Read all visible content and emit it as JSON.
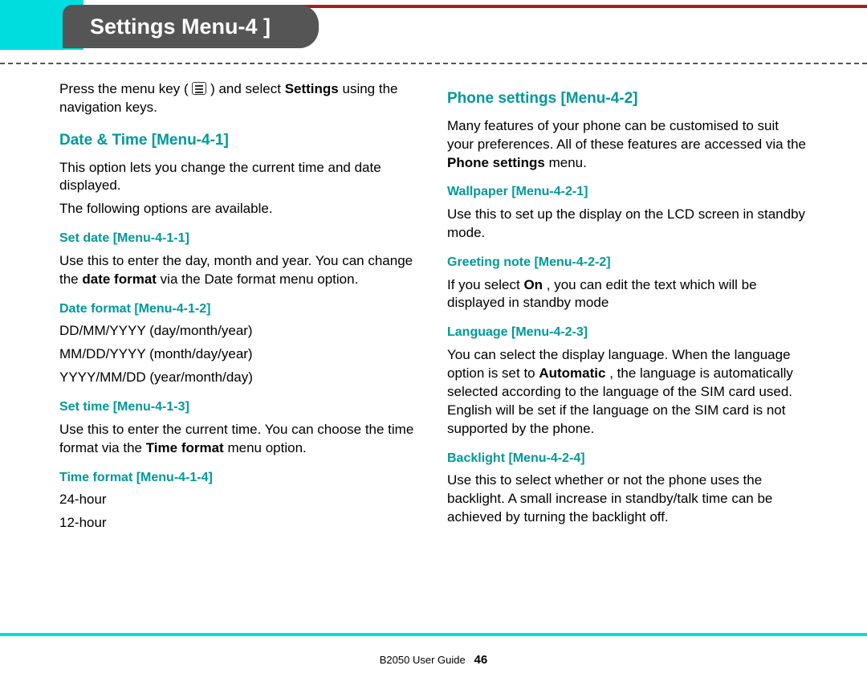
{
  "tab_title": "Settings Menu-4 ]",
  "left": {
    "intro_1a": "Press the menu key ( ",
    "intro_1b": " ) and select ",
    "intro_bold": "Settings",
    "intro_1c": " using the navigation keys.",
    "h1": "Date & Time [Menu-4-1]",
    "p1": "This option lets you change the current time and date displayed.",
    "p2": "The following options are available.",
    "h1a": "Set date [Menu-4-1-1]",
    "p1a_a": "Use this to enter the day, month and year. You can change the ",
    "p1a_bold": "date format",
    "p1a_b": " via the Date format menu option.",
    "h1b": "Date format [Menu-4-1-2]",
    "df1": "DD/MM/YYYY (day/month/year)",
    "df2": "MM/DD/YYYY (month/day/year)",
    "df3": "YYYY/MM/DD (year/month/day)",
    "h1c": "Set time [Menu-4-1-3]",
    "p1c_a": "Use this to enter the current time. You can choose the time format via the ",
    "p1c_bold": "Time format",
    "p1c_b": " menu option.",
    "h1d": "Time format [Menu-4-1-4]",
    "tf1": "24-hour",
    "tf2": "12-hour"
  },
  "right": {
    "h2": "Phone settings [Menu-4-2]",
    "p2_a": "Many features of your phone can be customised to suit your preferences. All of these features are accessed via the ",
    "p2_bold": "Phone settings",
    "p2_b": " menu.",
    "h2a": "Wallpaper [Menu-4-2-1]",
    "p2a": "Use this to set up the display on the LCD screen in standby mode.",
    "h2b": "Greeting note [Menu-4-2-2]",
    "p2b_a": "If you select ",
    "p2b_bold": "On",
    "p2b_b": ", you can edit the text which will be displayed in standby mode",
    "h2c": "Language [Menu-4-2-3]",
    "p2c_a": "You can select the display language. When the language option is set to ",
    "p2c_bold": "Automatic",
    "p2c_b": ", the language is automatically selected according to the language of the SIM card used. English will be set if the language on the SIM card is not supported by the phone.",
    "h2d": "Backlight [Menu-4-2-4]",
    "p2d": "Use this to select whether or not the phone uses the backlight. A small increase in standby/talk time can be achieved by turning the backlight off."
  },
  "footer": {
    "guide": "B2050 User Guide",
    "page": "46"
  }
}
